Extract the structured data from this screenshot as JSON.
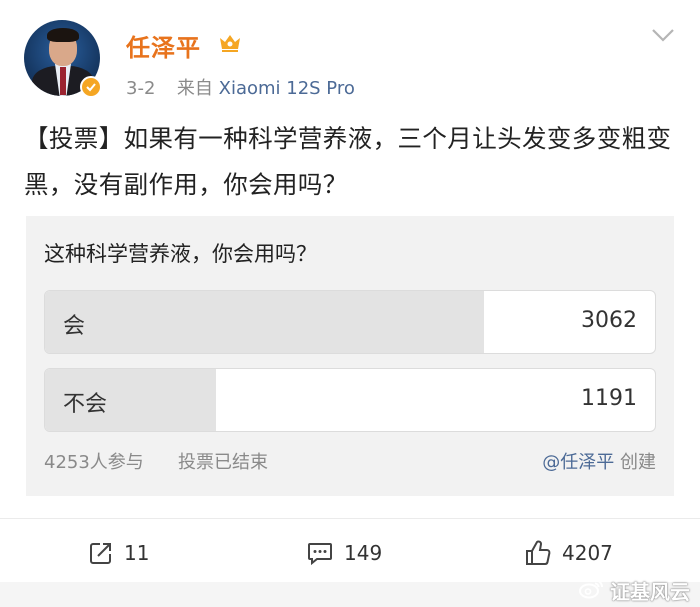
{
  "post": {
    "author": "任泽平",
    "date": "3-2",
    "source_prefix": "来自",
    "source": "Xiaomi 12S Pro",
    "text": "【投票】如果有一种科学营养液，三个月让头发变多变粗变黑，没有副作用，你会用吗？"
  },
  "poll": {
    "question": "这种科学营养液，你会用吗？",
    "options": [
      {
        "label": "会",
        "count": "3062",
        "share": 0.72
      },
      {
        "label": "不会",
        "count": "1191",
        "share": 0.28
      }
    ],
    "participants": "4253人参与",
    "status": "投票已结束",
    "creator_mention": "@任泽平",
    "creator_suffix": "创建"
  },
  "actions": {
    "repost_count": "11",
    "comment_count": "149",
    "like_count": "4207"
  },
  "watermark": "证基风云",
  "colors": {
    "author": "#e8731c",
    "link": "#4c6a96",
    "muted": "#8a8a8a",
    "card_bg": "#f2f2f2",
    "bar_fill": "#e3e3e3",
    "verified": "#f5a623"
  },
  "icons": [
    "verified-icon",
    "vip-icon",
    "chevron-down-icon",
    "repost-icon",
    "comment-icon",
    "like-icon",
    "weibo-logo-icon"
  ]
}
